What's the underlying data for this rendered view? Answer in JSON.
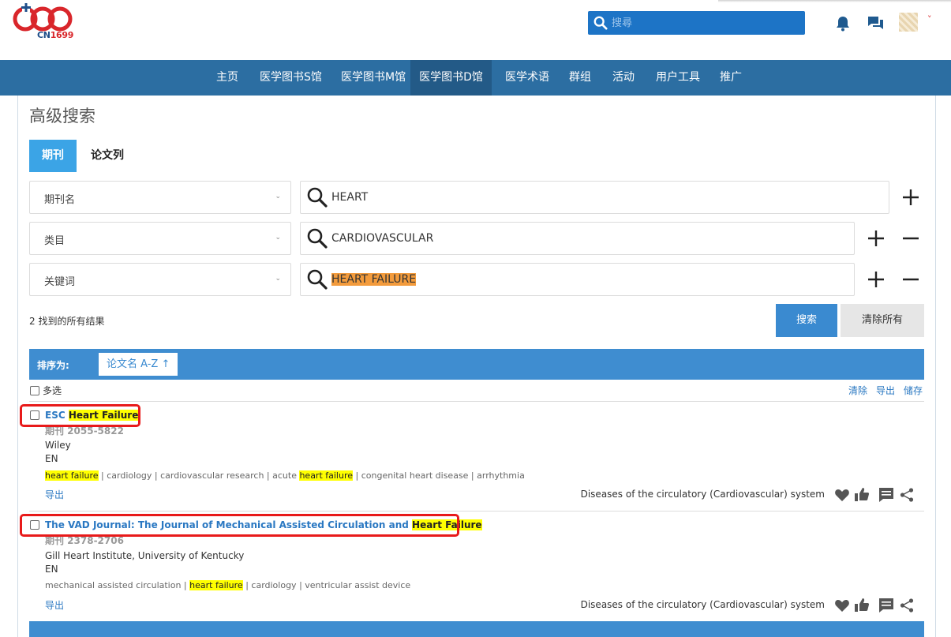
{
  "brand": {
    "logo_text": "CN",
    "logo_number": "1699",
    "accent": "#d9262b",
    "blue": "#1f4f8a"
  },
  "search": {
    "placeholder": "搜尋"
  },
  "header_icons": [
    "bell-icon",
    "chat-icon",
    "avatar",
    "chevron-down-icon"
  ],
  "nav": {
    "items": [
      {
        "label": "主页"
      },
      {
        "label": "医学图书S馆"
      },
      {
        "label": "医学图书M馆"
      },
      {
        "label": "医学图书D馆",
        "active": true
      },
      {
        "label": "医学术语"
      },
      {
        "label": "群组"
      },
      {
        "label": "活动"
      },
      {
        "label": "用户工具"
      },
      {
        "label": "推广"
      }
    ]
  },
  "page": {
    "title": "高级搜索"
  },
  "tabs": [
    {
      "label": "期刊",
      "active": true
    },
    {
      "label": "论文列"
    }
  ],
  "criteria": [
    {
      "field": "期刊名",
      "value": "HEART",
      "ops": [
        "+"
      ]
    },
    {
      "field": "类目",
      "value": "CARDIOVASCULAR",
      "ops": [
        "+",
        "−"
      ]
    },
    {
      "field": "关键词",
      "value": "HEART FAILURE",
      "ops": [
        "+",
        "−"
      ],
      "highlighted": true
    }
  ],
  "results_count": "2 找到的所有结果",
  "buttons": {
    "search": "搜索",
    "clear_all": "清除所有"
  },
  "sort": {
    "label": "排序为:",
    "value": "论文名 A-Z"
  },
  "list_actions": {
    "multi_select": "多选",
    "clear": "清除",
    "export": "导出",
    "save": "储存"
  },
  "results": [
    {
      "title_pre": "ESC ",
      "title_hl": "Heart Failure",
      "issn": "期刊 2055-5822",
      "publisher": "Wiley",
      "lang": "EN",
      "keywords": [
        {
          "t": "heart failure",
          "hl": true
        },
        {
          "t": " | cardiology | cardiovascular research | acute ",
          "hl": false
        },
        {
          "t": "heart failure",
          "hl": true
        },
        {
          "t": " | congenital heart disease | arrhythmia",
          "hl": false
        }
      ],
      "export": "导出",
      "category": "Diseases of the circulatory (Cardiovascular) system"
    },
    {
      "title_pre": "The VAD Journal: The Journal of Mechanical Assisted Circulation and ",
      "title_hl": "Heart Failure",
      "issn": "期刊 2378-2706",
      "publisher": "Gill Heart Institute, University of Kentucky",
      "lang": "EN",
      "keywords": [
        {
          "t": "mechanical assisted circulation | ",
          "hl": false
        },
        {
          "t": "heart failure",
          "hl": true
        },
        {
          "t": " | cardiology | ventricular assist device",
          "hl": false
        }
      ],
      "export": "导出",
      "category": "Diseases of the circulatory (Cardiovascular) system"
    }
  ],
  "colors": {
    "nav": "#2c6ea2",
    "nav_active": "#235a87",
    "tab_active": "#3ba4e6",
    "button": "#3a8ad0",
    "highlight": "#ffff00",
    "annotation_red": "#e81a1a"
  }
}
